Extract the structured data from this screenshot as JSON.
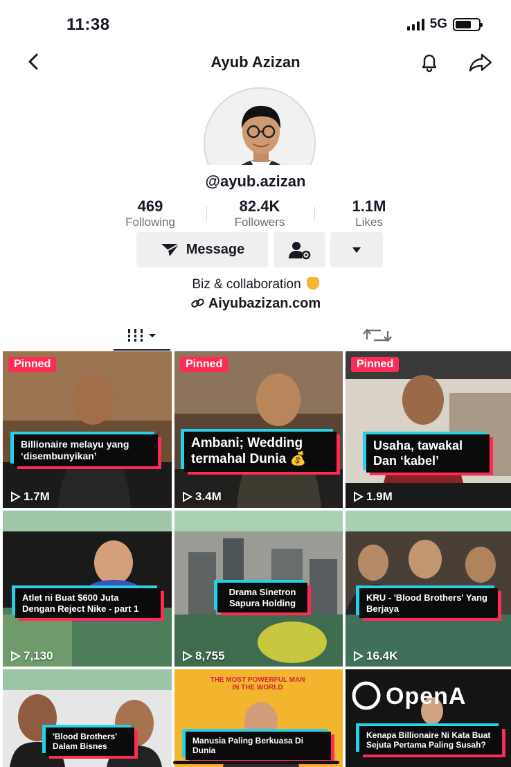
{
  "status": {
    "time": "11:38",
    "network": "5G"
  },
  "nav": {
    "title": "Ayub Azizan"
  },
  "profile": {
    "username": "@ayub.azizan",
    "stats": [
      {
        "value": "469",
        "label": "Following"
      },
      {
        "value": "82.4K",
        "label": "Followers"
      },
      {
        "value": "1.1M",
        "label": "Likes"
      }
    ],
    "message_label": "Message",
    "bio": "Biz & collaboration",
    "link": "Aiyubazizan.com"
  },
  "videos": [
    {
      "pinned": "Pinned",
      "caption": "Billionaire melayu yang ‘disembunyikan’",
      "views": "1.7M"
    },
    {
      "pinned": "Pinned",
      "caption": "Ambani; Wedding termahal Dunia 💰",
      "views": "3.4M"
    },
    {
      "pinned": "Pinned",
      "caption": "Usaha, tawakal Dan ‘kabel’",
      "views": "1.9M"
    },
    {
      "caption": "Atlet ni Buat $600 Juta Dengan Reject Nike - part 1",
      "views": "7,130"
    },
    {
      "caption": "Drama Sinetron Sapura Holding",
      "views": "8,755"
    },
    {
      "caption": "KRU - 'Blood Brothers' Yang Berjaya",
      "views": "16.4K"
    },
    {
      "caption": "'Blood Brothers' Dalam Bisnes",
      "views": ""
    },
    {
      "caption": "Manusia Paling Berkuasa Di Dunia",
      "overlay": "THE MOST POWERFUL MAN IN THE WORLD",
      "views": ""
    },
    {
      "caption": "Kenapa Billionaire Ni Kata Buat Sejuta Pertama Paling Susah?",
      "overlay": "OpenA",
      "views": ""
    }
  ],
  "colors": {
    "accent": "#fe2c55",
    "cyan": "#25d0e8",
    "button_bg": "#efeff0"
  }
}
